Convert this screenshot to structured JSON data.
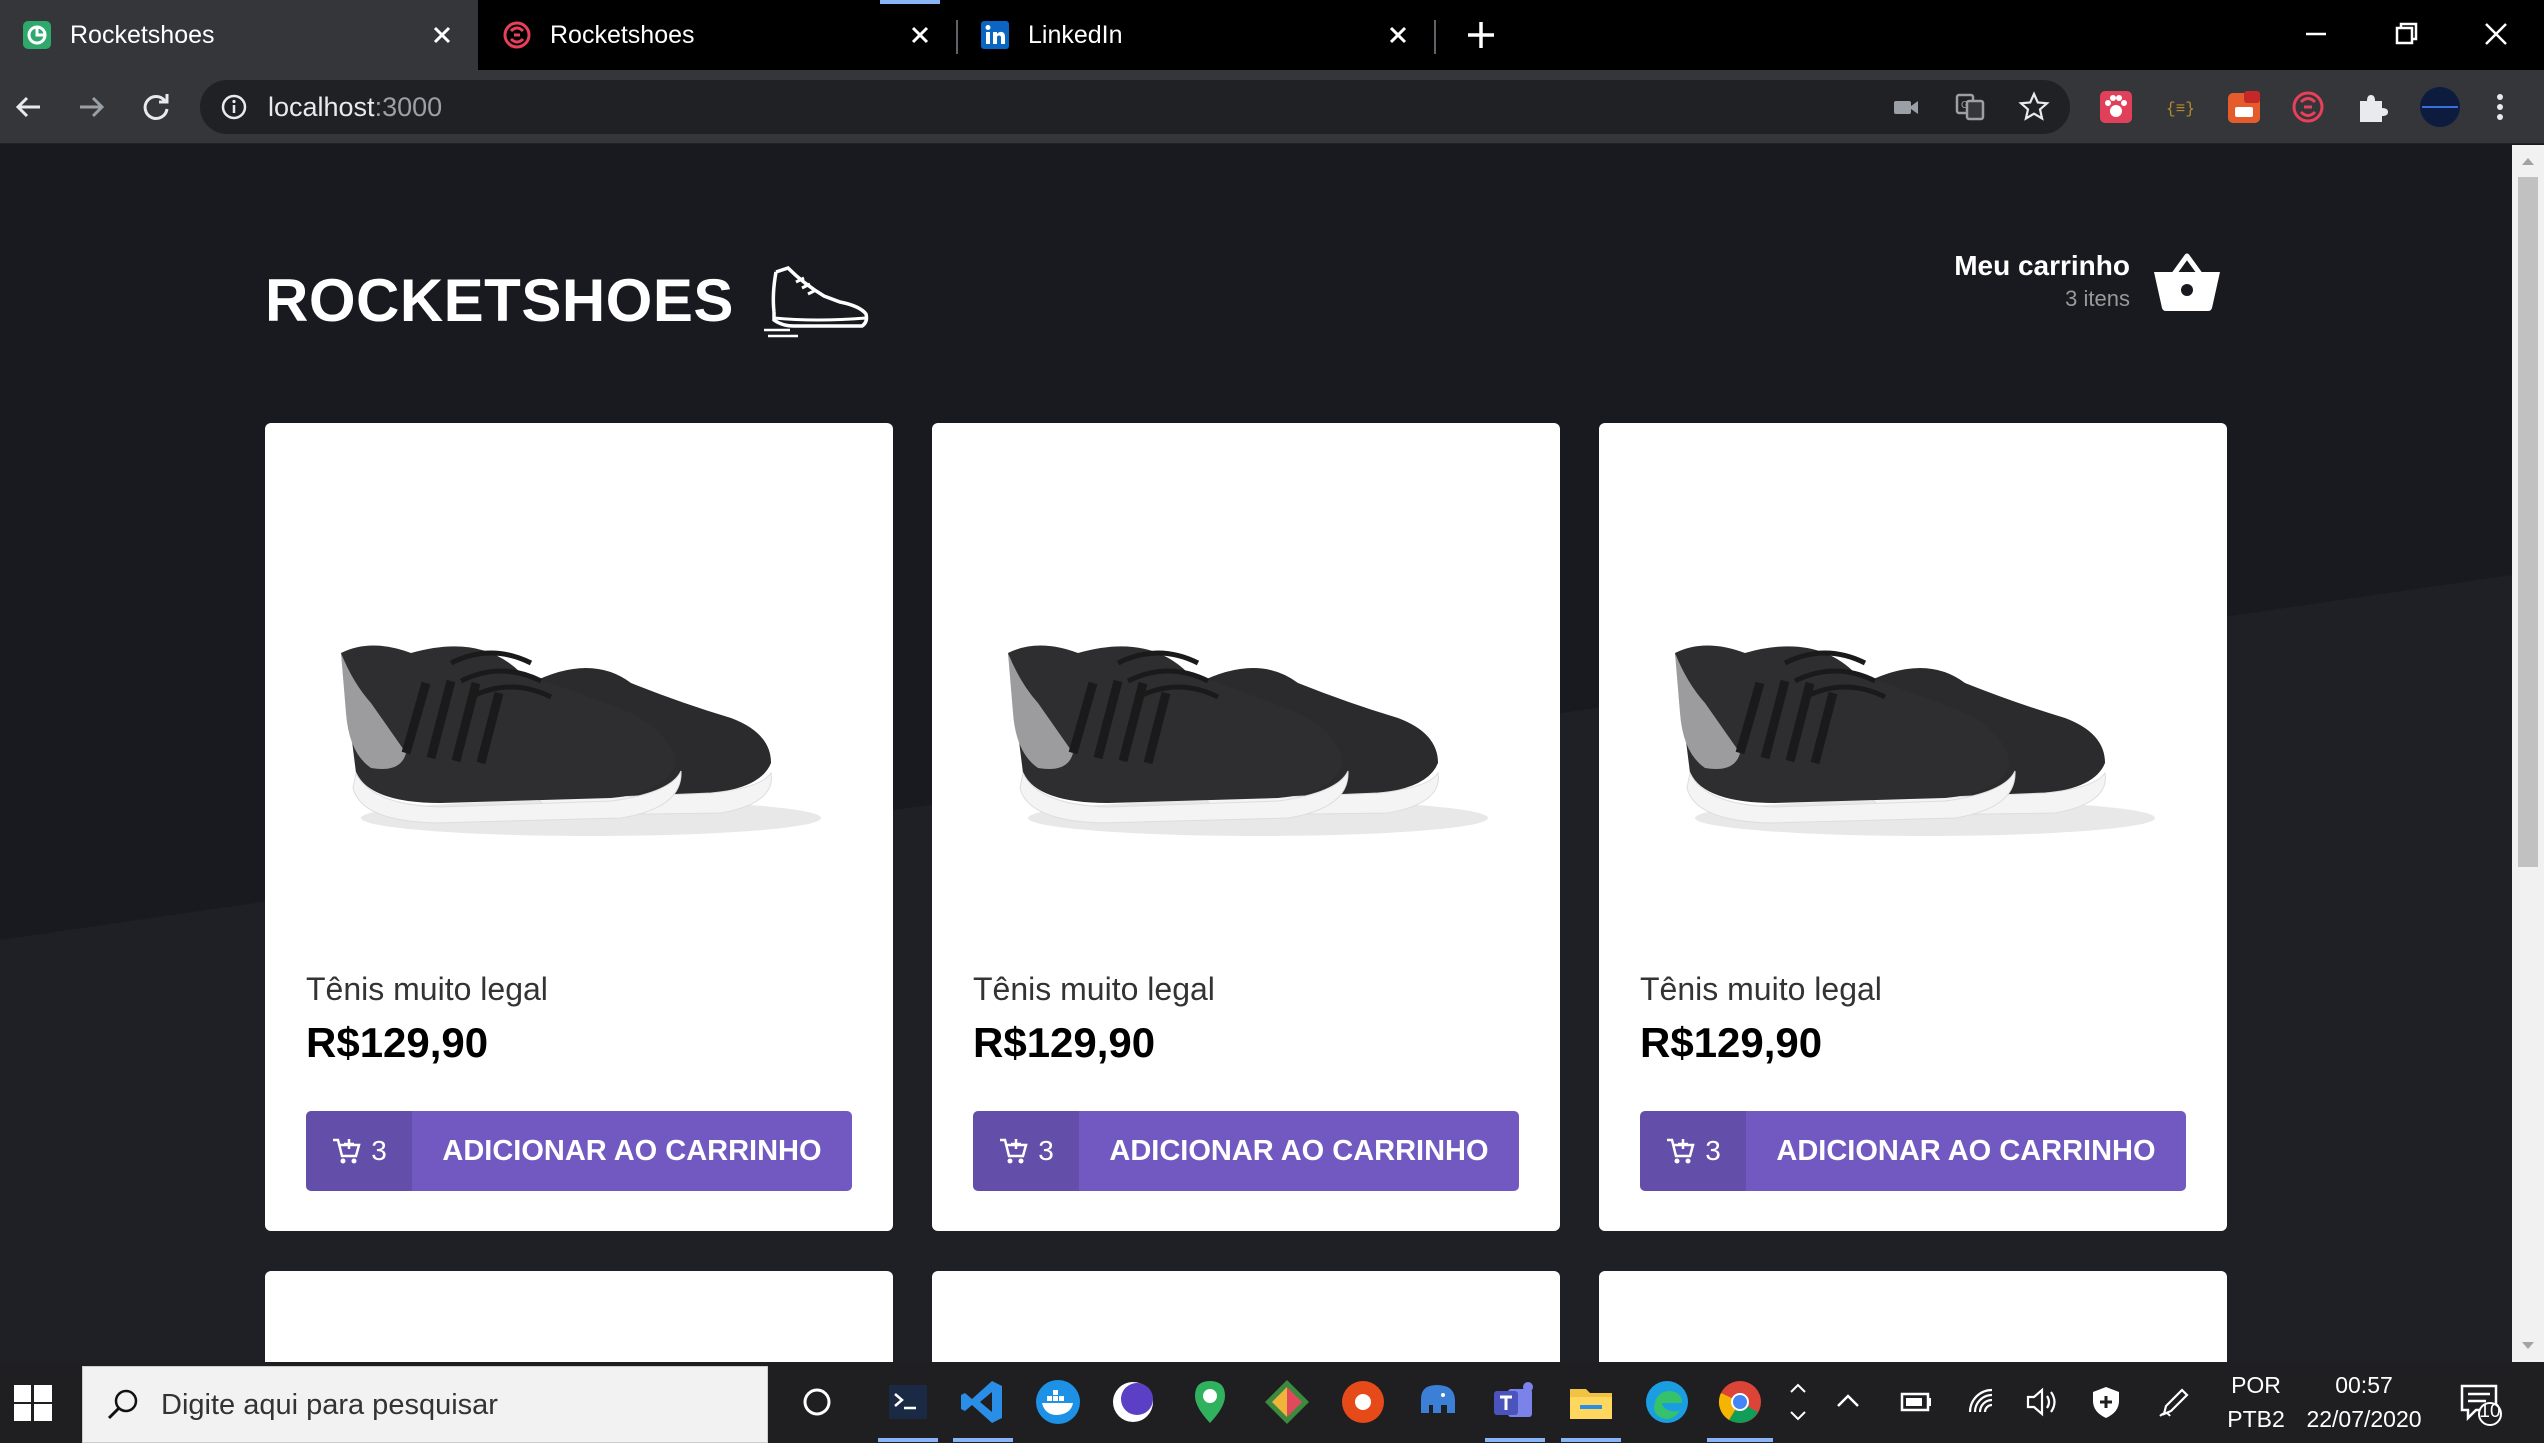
{
  "browser": {
    "tabs": [
      {
        "title": "Rocketshoes",
        "icon": "rocketshoes-favicon",
        "active": true
      },
      {
        "title": "Rocketshoes",
        "icon": "rocketseat-favicon",
        "active": false
      },
      {
        "title": "LinkedIn",
        "icon": "linkedin-favicon",
        "active": false
      }
    ],
    "url_host": "localhost",
    "url_port": ":3000"
  },
  "header": {
    "logo": "ROCKETSHOES",
    "cart_title": "Meu carrinho",
    "cart_count": "3 itens"
  },
  "products": [
    {
      "title": "Tênis muito legal",
      "price": "R$129,90",
      "qty": "3",
      "button": "ADICIONAR AO CARRINHO"
    },
    {
      "title": "Tênis muito legal",
      "price": "R$129,90",
      "qty": "3",
      "button": "ADICIONAR AO CARRINHO"
    },
    {
      "title": "Tênis muito legal",
      "price": "R$129,90",
      "qty": "3",
      "button": "ADICIONAR AO CARRINHO"
    }
  ],
  "taskbar": {
    "search_placeholder": "Digite aqui para pesquisar",
    "lang": "POR",
    "layout": "PTB2",
    "time": "00:57",
    "date": "22/07/2020",
    "notifications": "10"
  },
  "colors": {
    "page_bg": "#191920",
    "accent": "#7159c1",
    "tab_active": "#35363a"
  }
}
